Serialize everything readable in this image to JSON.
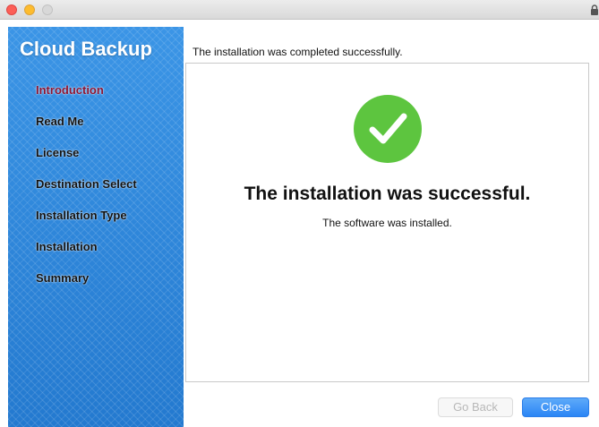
{
  "sidebar": {
    "app_title": "Cloud Backup",
    "steps": [
      {
        "label": "Introduction",
        "current": true
      },
      {
        "label": "Read Me"
      },
      {
        "label": "License"
      },
      {
        "label": "Destination Select"
      },
      {
        "label": "Installation Type"
      },
      {
        "label": "Installation"
      },
      {
        "label": "Summary"
      }
    ]
  },
  "main": {
    "status_line": "The installation was completed successfully.",
    "headline": "The installation was successful.",
    "subline": "The software was installed.",
    "icon": "checkmark-circle-icon"
  },
  "buttons": {
    "back_label": "Go Back",
    "close_label": "Close"
  },
  "colors": {
    "success_green": "#5dc53f",
    "sidebar_blue": "#2c86d9",
    "current_step": "#8a1432",
    "primary_button": "#2a85f5"
  }
}
